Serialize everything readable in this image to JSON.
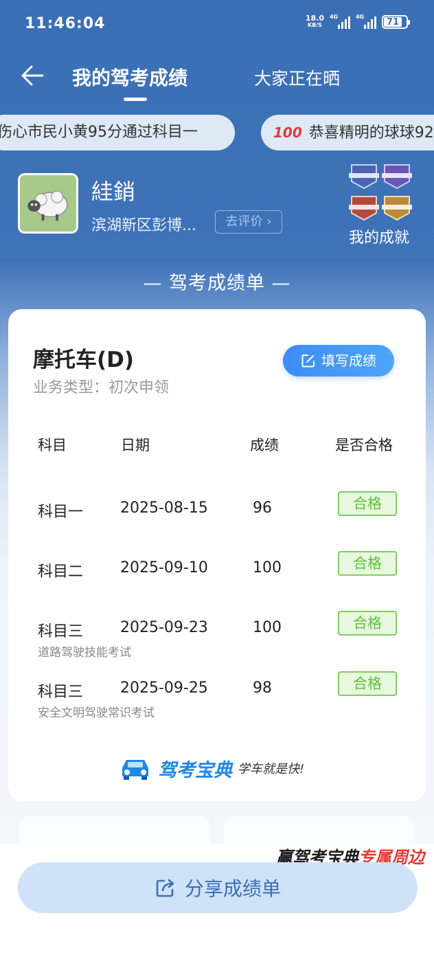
{
  "status_bar": {
    "time": "11:46:04",
    "net_speed": "18.0",
    "net_unit": "KB/S",
    "sig1_label": "4G",
    "sig2_label": "4G",
    "battery": "71"
  },
  "nav": {
    "tab_active": "我的驾考成绩",
    "tab_other": "大家正在晒"
  },
  "ticker": {
    "items": [
      "伤心市民小黄95分通过科目一",
      "恭喜精明的球球92"
    ],
    "emoji2": "100"
  },
  "profile": {
    "name": "絓銷",
    "school": "滨湖新区彭博...",
    "rate_button": "去评价",
    "achievements_label": "我的成就"
  },
  "section_title": "— 驾考成绩单 —",
  "card": {
    "vehicle": "摩托车(D)",
    "business_type": "业务类型：初次申领",
    "fill_button": "填写成绩",
    "headers": {
      "subject": "科目",
      "date": "日期",
      "score": "成绩",
      "passed": "是否合格"
    },
    "rows": [
      {
        "subject": "科目一",
        "date": "2025-08-15",
        "score": "96",
        "status": "合格",
        "sub": ""
      },
      {
        "subject": "科目二",
        "date": "2025-09-10",
        "score": "100",
        "status": "合格",
        "sub": ""
      },
      {
        "subject": "科目三",
        "date": "2025-09-23",
        "score": "100",
        "status": "合格",
        "sub": "道路驾驶技能考试"
      },
      {
        "subject": "科目三",
        "date": "2025-09-25",
        "score": "98",
        "status": "合格",
        "sub": "安全文明驾驶常识考试"
      }
    ],
    "brand_name": "驾考宝典",
    "brand_slogan": "学车就是快!"
  },
  "promo": {
    "part1": "赢驾考宝典",
    "part2": "专属周边"
  },
  "share_button": "分享成绩单",
  "colors": {
    "header_blue": "#3a6fb5",
    "pass_green": "#5ec13b",
    "button_blue": "#3d8df5"
  }
}
